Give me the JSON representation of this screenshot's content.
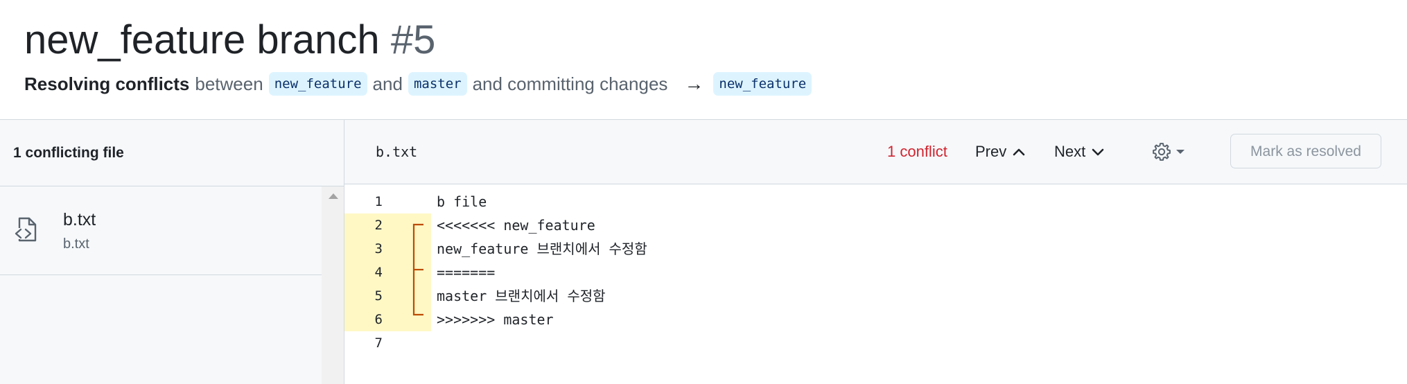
{
  "header": {
    "title": "new_feature branch",
    "number": "#5",
    "subtitle": {
      "strong": "Resolving conflicts",
      "between": "between",
      "head_branch": "new_feature",
      "and": "and",
      "base_branch": "master",
      "committing": "and committing changes",
      "arrow": "→",
      "target_branch": "new_feature"
    }
  },
  "sidebar": {
    "header": "1 conflicting file",
    "files": [
      {
        "name": "b.txt",
        "path": "b.txt",
        "icon": "file-code-icon"
      }
    ]
  },
  "toolbar": {
    "filename": "b.txt",
    "conflict_count": "1 conflict",
    "prev_label": "Prev",
    "next_label": "Next",
    "mark_resolved_label": "Mark as resolved"
  },
  "code": {
    "lines": [
      {
        "number": "1",
        "text": "b file",
        "conflict": false
      },
      {
        "number": "2",
        "text": "<<<<<<< new_feature",
        "conflict": true
      },
      {
        "number": "3",
        "text": "new_feature 브랜치에서 수정함",
        "conflict": true
      },
      {
        "number": "4",
        "text": "=======",
        "conflict": true
      },
      {
        "number": "5",
        "text": "master 브랜치에서 수정함",
        "conflict": true
      },
      {
        "number": "6",
        "text": ">>>>>>> master",
        "conflict": true
      },
      {
        "number": "7",
        "text": "",
        "conflict": false
      }
    ]
  },
  "colors": {
    "conflict_red": "#d1242f",
    "conflict_gutter": "#fff8c5",
    "branch_bg": "#ddf4ff",
    "bracket": "#bc4c00"
  }
}
